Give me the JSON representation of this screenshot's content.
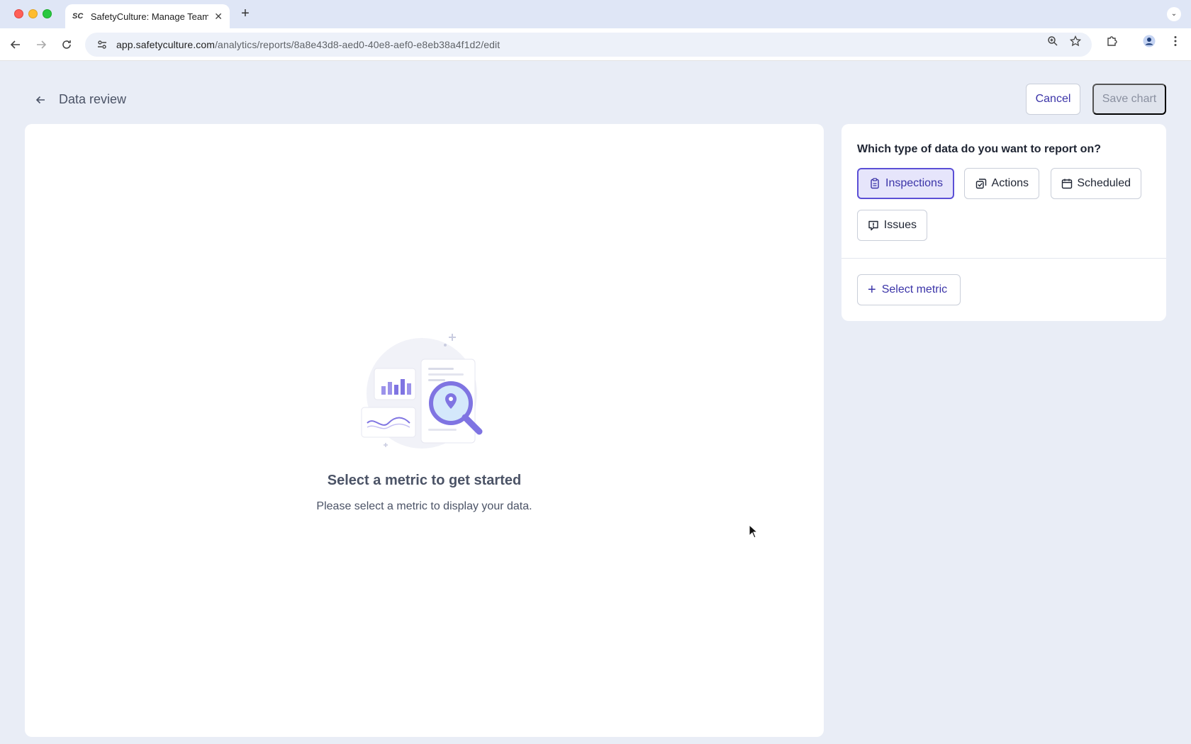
{
  "browser": {
    "tab_title": "SafetyCulture: Manage Teams",
    "tab_favicon": "SC",
    "new_tab_icon": "plus-icon",
    "url_host": "app.safetyculture.com",
    "url_path": "/analytics/reports/8a8e43d8-aed0-40e8-aef0-e8eb38a4f1d2/edit"
  },
  "header": {
    "title": "Data review",
    "cancel_label": "Cancel",
    "save_label": "Save chart"
  },
  "empty_state": {
    "title": "Select a metric to get started",
    "subtitle": "Please select a metric to display your data."
  },
  "panel": {
    "question": "Which type of data do you want to report on?",
    "types": [
      {
        "label": "Inspections",
        "icon": "clipboard-icon",
        "selected": true
      },
      {
        "label": "Actions",
        "icon": "actions-icon",
        "selected": false
      },
      {
        "label": "Scheduled",
        "icon": "calendar-icon",
        "selected": false
      },
      {
        "label": "Issues",
        "icon": "issue-icon",
        "selected": false
      }
    ],
    "select_metric_label": "Select metric"
  },
  "colors": {
    "accent": "#5b4fd6",
    "accent_text": "#3b34a8",
    "page_bg": "#e9edf6"
  }
}
